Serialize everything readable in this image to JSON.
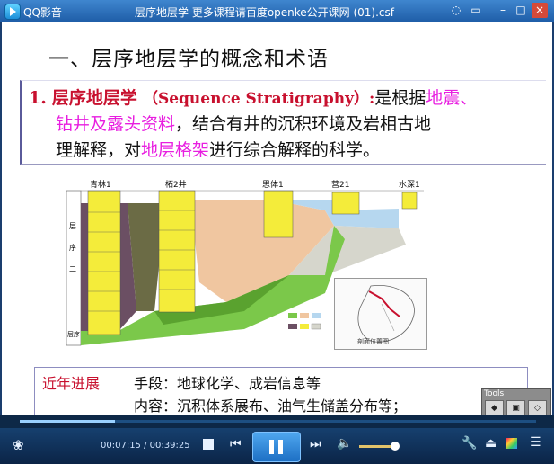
{
  "window": {
    "app_name": "QQ影音",
    "title": "层序地层学 更多课程请百度openke公开课网 (01).csf",
    "buttons": [
      "◌",
      "▭",
      "–",
      "□",
      "×"
    ]
  },
  "slide": {
    "heading": "一、层序地层学的概念和术语",
    "definition": {
      "number": "1.",
      "term": "层序地层学",
      "term_en": "（Sequence Stratigraphy）:",
      "line1_rest": "是根据",
      "line1_highlight": "地震、",
      "line2_highlight": "钻井及露头资料",
      "line2_rest": "，结合有井的沉积环境及岩相古地",
      "line3_a": "理解释，对",
      "line3_highlight": "地层格架",
      "line3_b": "进行综合解释的科学。"
    },
    "diagram": {
      "well_labels": [
        "青林1",
        "柘2井",
        "思体1",
        "营21",
        "水深1"
      ],
      "left_axis_labels": [
        "层",
        "序",
        "二",
        "层序"
      ],
      "map_caption": "剖面位置图"
    },
    "progress": {
      "label": "近年进展",
      "line1": "手段：地球化学、成岩信息等",
      "line2": "内容：沉积体系展布、油气生储盖分布等；"
    }
  },
  "tools": {
    "title": "Tools",
    "buttons": [
      "◆",
      "▣",
      "◇"
    ]
  },
  "player": {
    "time": "00:07:15 / 00:39:25",
    "progress_fraction": 0.184,
    "volume_fraction": 0.9
  },
  "colors": {
    "title_red": "#c8102e",
    "highlight_magenta": "#e81ee0",
    "title_bar": "#1f5ea8"
  }
}
